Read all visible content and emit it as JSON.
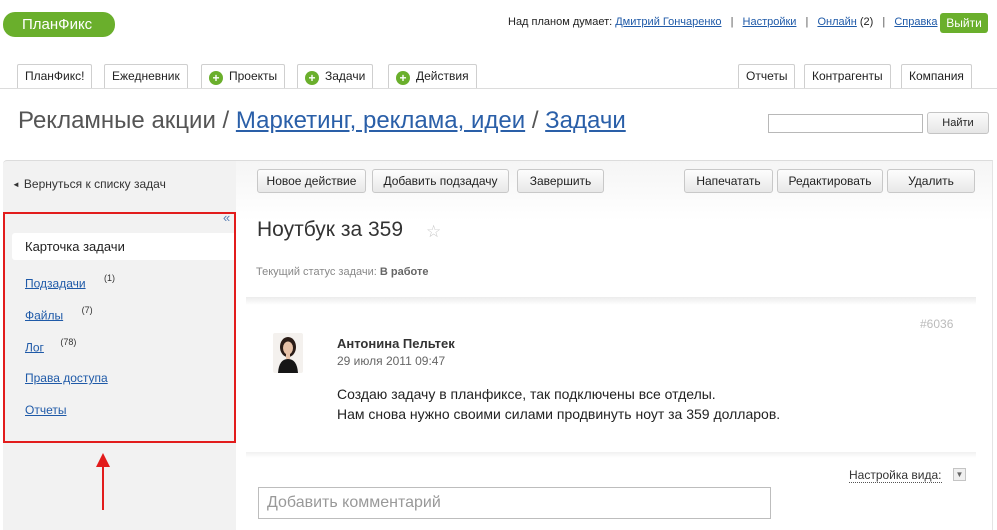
{
  "header": {
    "logo": "ПланФикс",
    "thinking_label": "Над планом думает:",
    "user": "Дмитрий Гончаренко",
    "settings": "Настройки",
    "online": "Онлайн",
    "online_count": "(2)",
    "help": "Справка",
    "exit": "Выйти"
  },
  "tabs": {
    "left": [
      "ПланФикс!",
      "Ежедневник",
      "Проекты",
      "Задачи",
      "Действия"
    ],
    "right": [
      "Отчеты",
      "Контрагенты",
      "Компания"
    ]
  },
  "breadcrumb": {
    "root": "Рекламные акции",
    "sep": "/",
    "project": "Маркетинг, реклама, идеи",
    "section": "Задачи"
  },
  "search": {
    "button": "Найти",
    "value": ""
  },
  "sidebar": {
    "back": "Вернуться к списку задач",
    "collapse": "«",
    "active_item": "Карточка задачи",
    "items": [
      {
        "label": "Подзадачи",
        "count": "(1)"
      },
      {
        "label": "Файлы",
        "count": "(7)"
      },
      {
        "label": "Лог",
        "count": "(78)"
      },
      {
        "label": "Права доступа",
        "count": ""
      },
      {
        "label": "Отчеты",
        "count": ""
      }
    ]
  },
  "toolbar": {
    "new_action": "Новое действие",
    "add_subtask": "Добавить подзадачу",
    "finish": "Завершить",
    "print": "Напечатать",
    "edit": "Редактировать",
    "delete": "Удалить"
  },
  "task": {
    "title": "Ноутбук за 359",
    "status_label": "Текущий статус задачи:",
    "status_value": "В работе"
  },
  "comment": {
    "id": "#6036",
    "author": "Антонина Пельтек",
    "date": "29 июля 2011 09:47",
    "line1": "Создаю задачу в планфиксе, так подключены все отделы.",
    "line2": "Нам снова нужно своими силами продвинуть ноут за 359 долларов."
  },
  "footer": {
    "view_settings": "Настройка вида:",
    "comment_placeholder": "Добавить комментарий"
  },
  "colors": {
    "brand_green": "#6aaf2c",
    "link_blue": "#1f5aa8",
    "highlight_red": "#e21c1c"
  }
}
